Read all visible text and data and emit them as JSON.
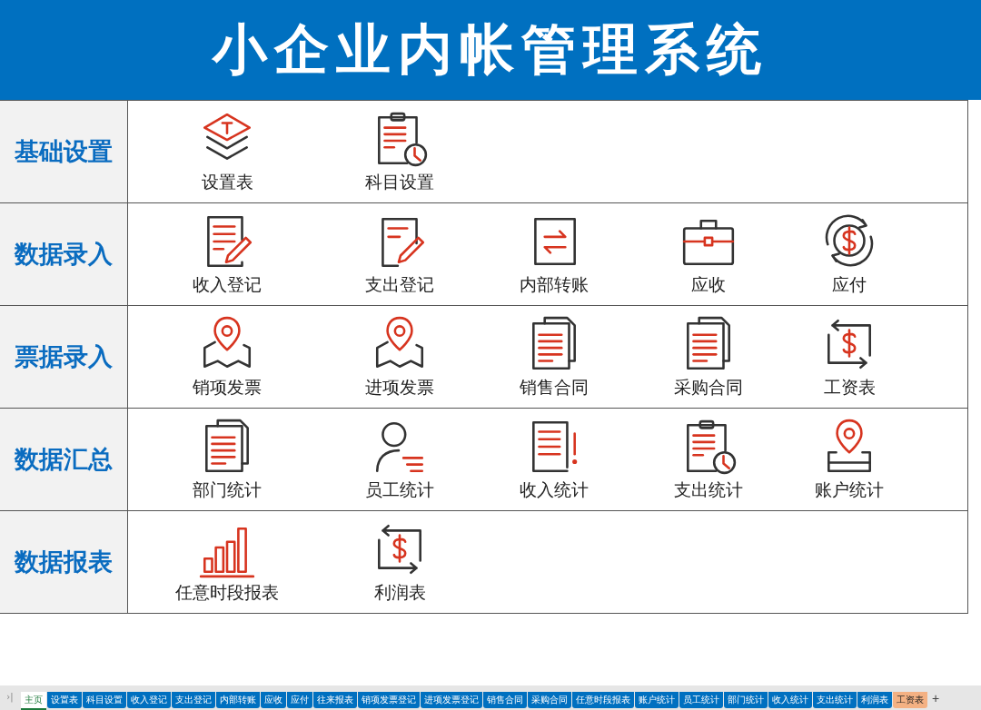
{
  "header": {
    "title": "小企业内帐管理系统"
  },
  "sections": [
    {
      "label": "基础设置",
      "items": [
        {
          "label": "设置表",
          "kind": "layers"
        },
        {
          "label": "科目设置",
          "kind": "clipboard-clock"
        }
      ]
    },
    {
      "label": "数据录入",
      "items": [
        {
          "label": "收入登记",
          "kind": "doc-pencil"
        },
        {
          "label": "支出登记",
          "kind": "note-pencil"
        },
        {
          "label": "内部转账",
          "kind": "transfer"
        },
        {
          "label": "应收",
          "kind": "briefcase"
        },
        {
          "label": "应付",
          "kind": "coin-cycle"
        }
      ]
    },
    {
      "label": "票据录入",
      "items": [
        {
          "label": "销项发票",
          "kind": "map-pin"
        },
        {
          "label": "进项发票",
          "kind": "map-pin"
        },
        {
          "label": "销售合同",
          "kind": "docs"
        },
        {
          "label": "采购合同",
          "kind": "docs"
        },
        {
          "label": "工资表",
          "kind": "money-arrows"
        }
      ]
    },
    {
      "label": "数据汇总",
      "items": [
        {
          "label": "部门统计",
          "kind": "docs"
        },
        {
          "label": "员工统计",
          "kind": "person-lines"
        },
        {
          "label": "收入统计",
          "kind": "doc-alert"
        },
        {
          "label": "支出统计",
          "kind": "clipboard-clock"
        },
        {
          "label": "账户统计",
          "kind": "pin-tray"
        }
      ]
    },
    {
      "label": "数据报表",
      "items": [
        {
          "label": "任意时段报表",
          "kind": "bar-chart"
        },
        {
          "label": "利润表",
          "kind": "money-arrows"
        }
      ]
    }
  ],
  "sheet_tabs": {
    "nav_glyph": "›|",
    "add_glyph": "+",
    "tabs": [
      {
        "label": "主页",
        "selected": true,
        "color": "#ffffff"
      },
      {
        "label": "设置表",
        "selected": false,
        "color": "#0070c0"
      },
      {
        "label": "科目设置",
        "selected": false,
        "color": "#0070c0"
      },
      {
        "label": "收入登记",
        "selected": false,
        "color": "#0070c0"
      },
      {
        "label": "支出登记",
        "selected": false,
        "color": "#0070c0"
      },
      {
        "label": "内部转账",
        "selected": false,
        "color": "#0070c0"
      },
      {
        "label": "应收",
        "selected": false,
        "color": "#0070c0"
      },
      {
        "label": "应付",
        "selected": false,
        "color": "#0070c0"
      },
      {
        "label": "往来报表",
        "selected": false,
        "color": "#0070c0"
      },
      {
        "label": "销项发票登记",
        "selected": false,
        "color": "#0070c0"
      },
      {
        "label": "进项发票登记",
        "selected": false,
        "color": "#0070c0"
      },
      {
        "label": "销售合同",
        "selected": false,
        "color": "#0070c0"
      },
      {
        "label": "采购合同",
        "selected": false,
        "color": "#0070c0"
      },
      {
        "label": "任意时段报表",
        "selected": false,
        "color": "#0070c0"
      },
      {
        "label": "账户统计",
        "selected": false,
        "color": "#0070c0"
      },
      {
        "label": "员工统计",
        "selected": false,
        "color": "#0070c0"
      },
      {
        "label": "部门统计",
        "selected": false,
        "color": "#0070c0"
      },
      {
        "label": "收入统计",
        "selected": false,
        "color": "#0070c0"
      },
      {
        "label": "支出统计",
        "selected": false,
        "color": "#0070c0"
      },
      {
        "label": "利润表",
        "selected": false,
        "color": "#0070c0"
      },
      {
        "label": "工资表",
        "selected": false,
        "color": "#f4b183"
      }
    ]
  }
}
